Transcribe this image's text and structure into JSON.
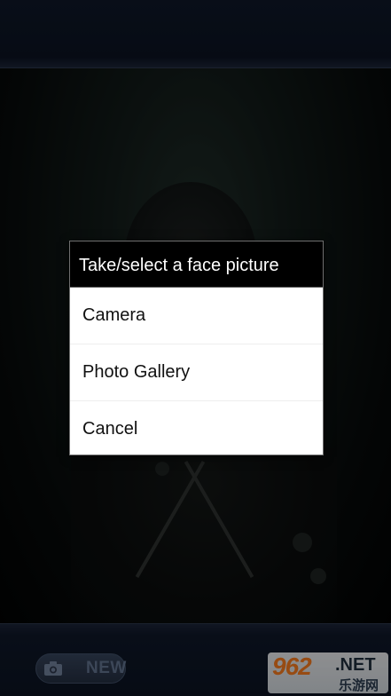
{
  "dialog": {
    "title": "Take/select a face picture",
    "options": [
      {
        "label": "Camera"
      },
      {
        "label": "Photo Gallery"
      },
      {
        "label": "Cancel"
      }
    ]
  },
  "bottom_bar": {
    "new_button_label": "NEW",
    "new_button_icon": "camera-icon"
  },
  "watermark": {
    "number": "962",
    "suffix": ".NET",
    "chinese": "乐游网"
  },
  "colors": {
    "dialog_title_bg": "#000000",
    "dialog_bg": "#ffffff",
    "bar_bg": "#0b1220",
    "watermark_accent": "#e8741e"
  }
}
